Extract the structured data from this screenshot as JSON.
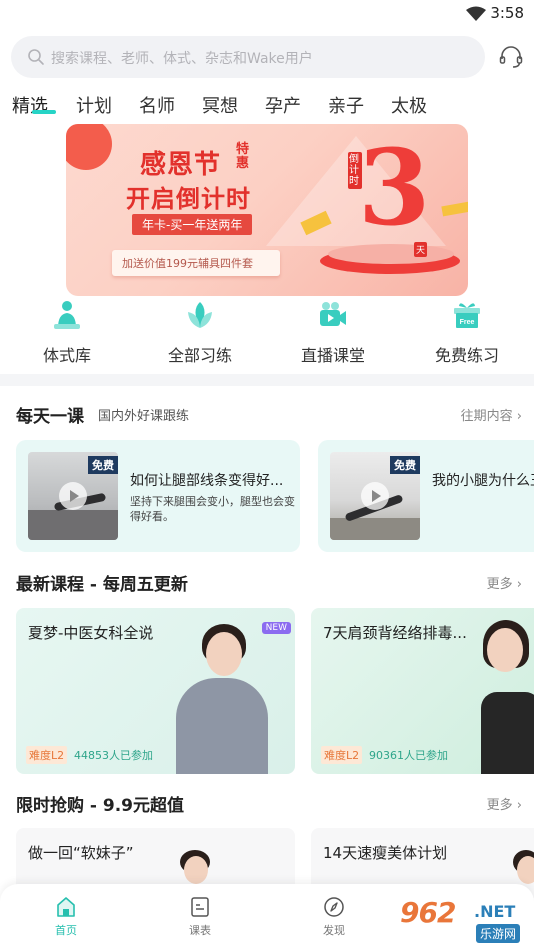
{
  "status_bar": {
    "time": "3:58",
    "wifi_icon": "wifi-icon"
  },
  "search": {
    "placeholder": "搜索课程、老师、体式、杂志和Wake用户",
    "icon": "search-icon",
    "service_icon": "headset-icon"
  },
  "tabs": [
    {
      "label": "精选",
      "active": true
    },
    {
      "label": "计划"
    },
    {
      "label": "名师"
    },
    {
      "label": "冥想"
    },
    {
      "label": "孕产"
    },
    {
      "label": "亲子"
    },
    {
      "label": "太极"
    }
  ],
  "banner": {
    "title_line1": "感恩节",
    "special": "特惠",
    "title_line2": "开启倒计时",
    "subtitle": "年卡-买一年送两年",
    "gift": "加送价值199元辅具四件套",
    "countdown_label": "倒计时",
    "countdown_number": "3",
    "countdown_unit": "天"
  },
  "quick_actions": [
    {
      "label": "体式库",
      "icon": "pose-library-icon"
    },
    {
      "label": "全部习练",
      "icon": "lotus-icon"
    },
    {
      "label": "直播课堂",
      "icon": "live-camera-icon"
    },
    {
      "label": "免费练习",
      "icon": "free-gift-icon",
      "icon_text": "Free"
    }
  ],
  "daily": {
    "title": "每天一课",
    "subtitle": "国内外好课跟练",
    "more": "往期内容",
    "cards": [
      {
        "tag": "免费",
        "title": "如何让腿部线条变得好...",
        "desc": "坚持下来腿围会变小，腿型也会变得好看。"
      },
      {
        "tag": "免费",
        "title": "我的小腿为什么王"
      }
    ]
  },
  "latest": {
    "title": "最新课程 - 每周五更新",
    "more": "更多",
    "cards": [
      {
        "title": "夏梦-中医女科全说",
        "badge": "NEW",
        "level": "难度L2",
        "participants": "44853人已参加"
      },
      {
        "title": "7天肩颈背经络排毒...",
        "level": "难度L2",
        "participants": "90361人已参加"
      }
    ]
  },
  "flash_sale": {
    "title": "限时抢购 - 9.9元超值",
    "more": "更多",
    "cards": [
      {
        "title": "做一回“软妹子”"
      },
      {
        "title": "14天速瘦美体计划"
      }
    ]
  },
  "bottom_nav": [
    {
      "label": "首页",
      "icon": "home-icon",
      "active": true
    },
    {
      "label": "课表",
      "icon": "schedule-icon"
    },
    {
      "label": "发现",
      "icon": "discover-icon"
    }
  ],
  "watermark": {
    "number": "962",
    "suffix": ".NET",
    "site": "乐游网"
  },
  "colors": {
    "accent": "#26d4c6",
    "banner_red": "#e2312c",
    "card_mint": "#e8f8f6"
  }
}
